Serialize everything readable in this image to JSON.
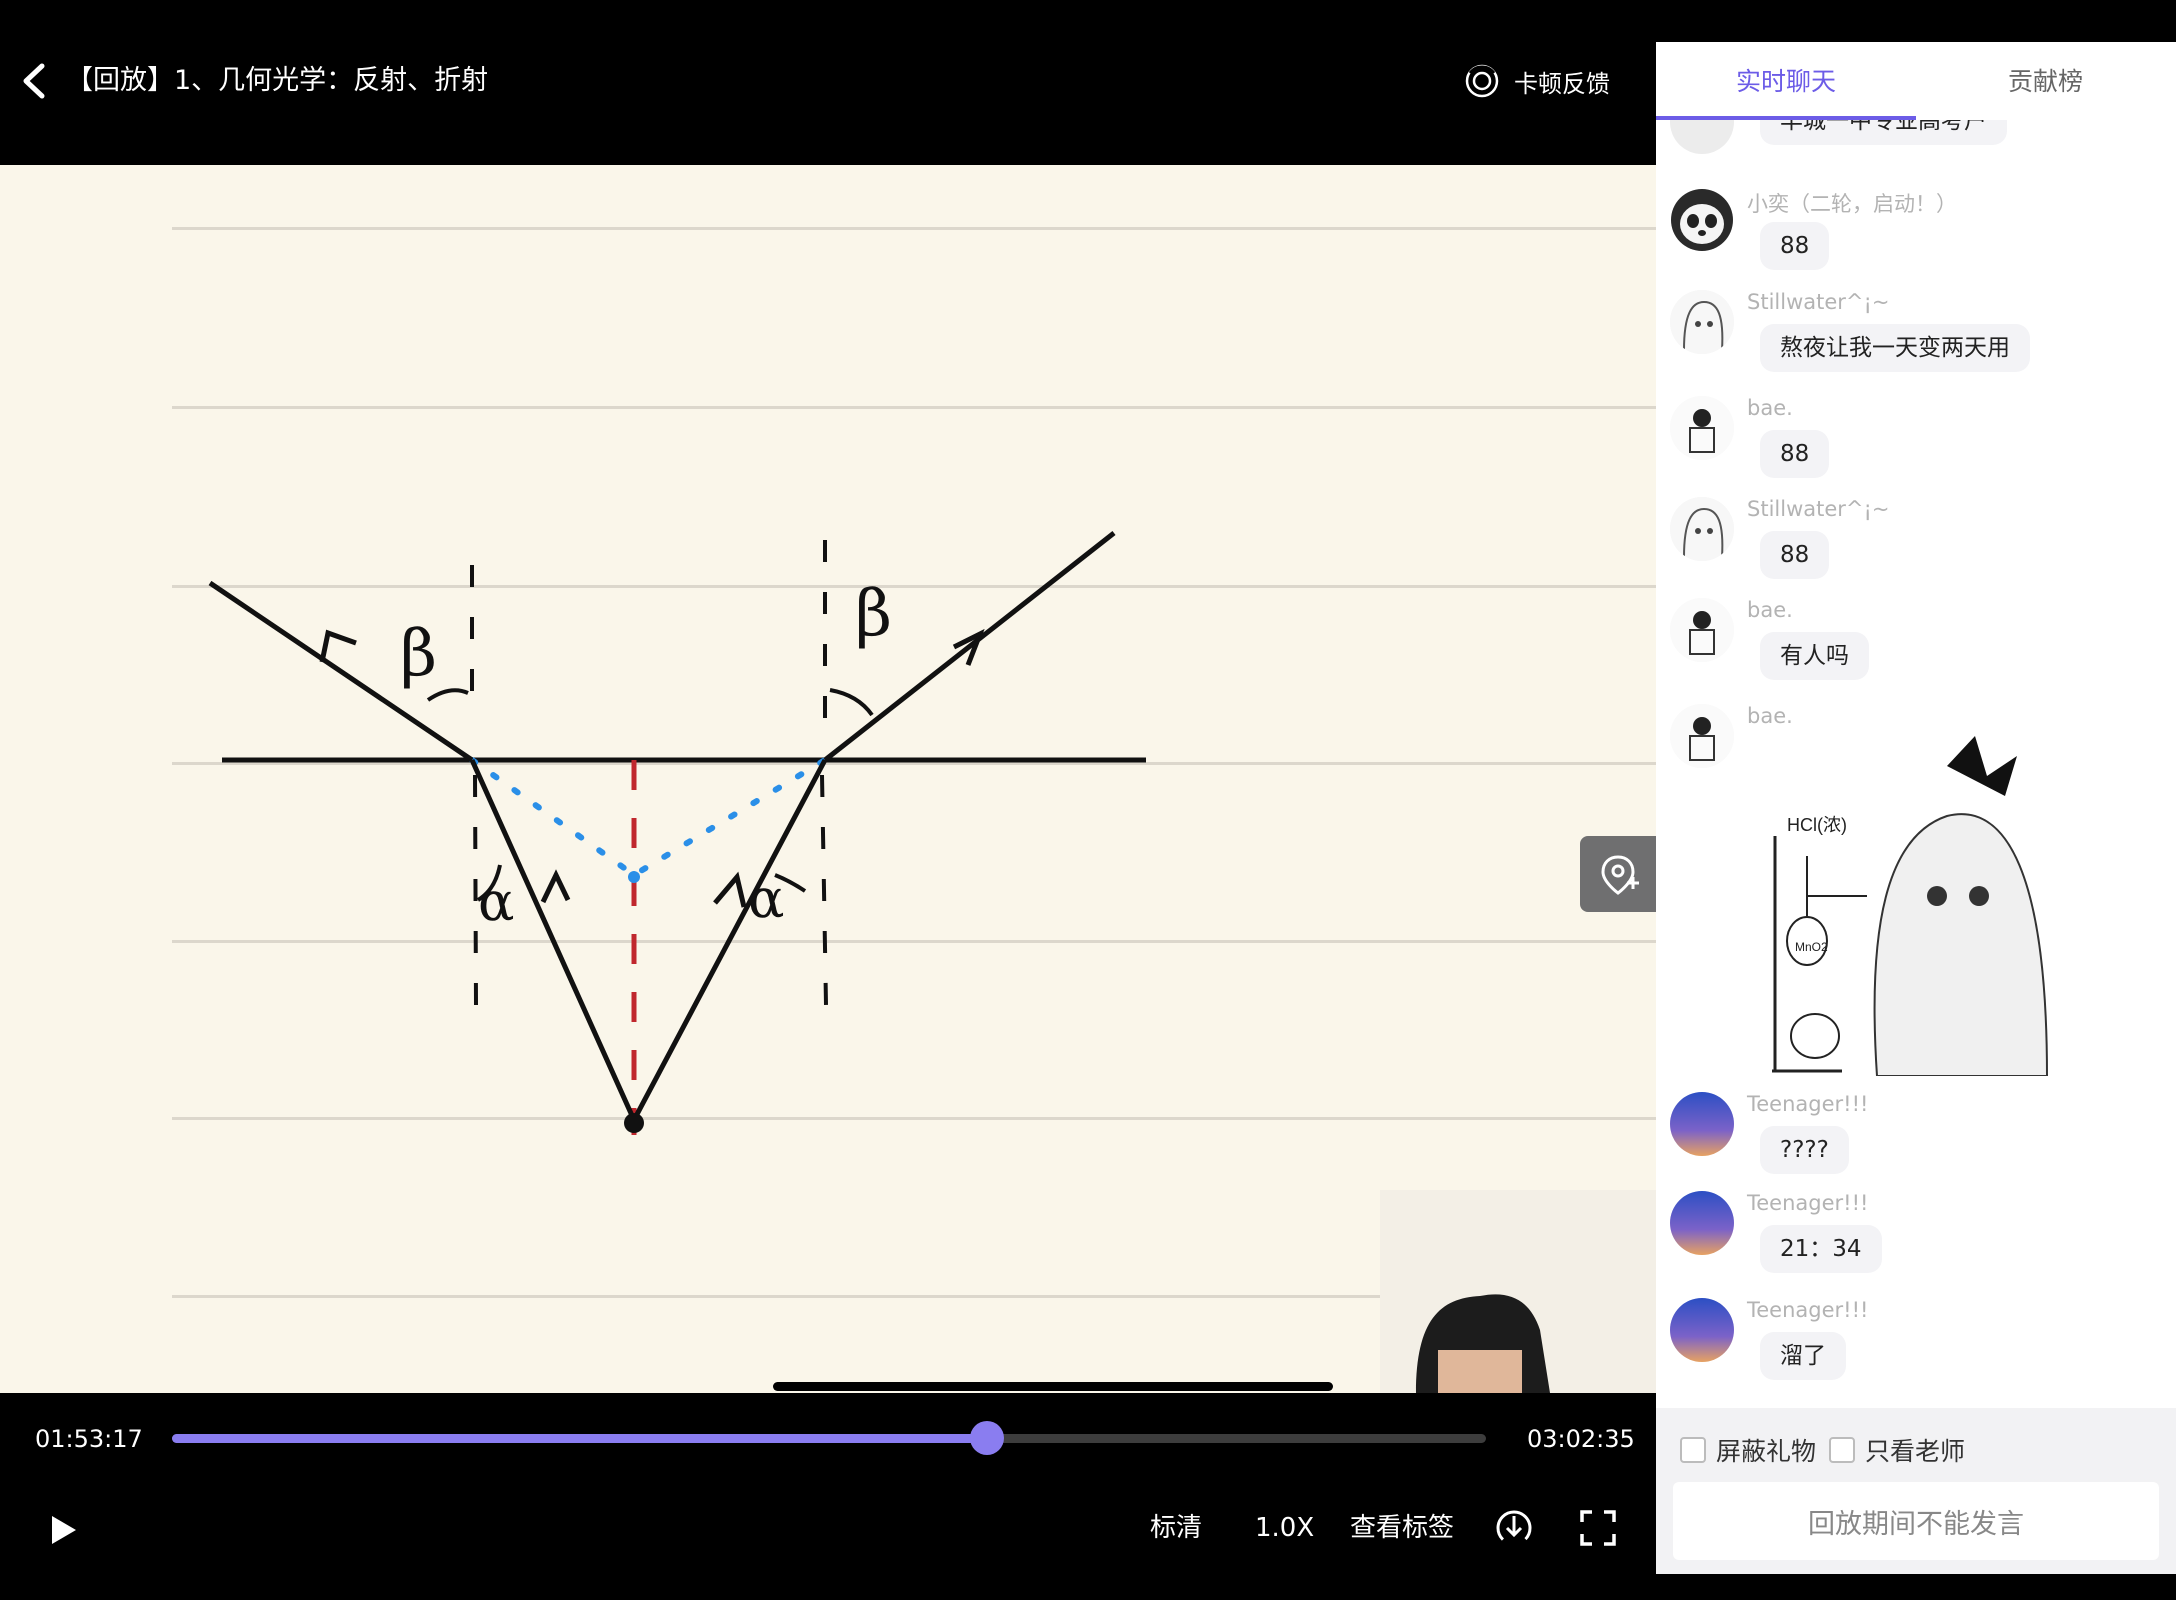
{
  "header": {
    "title": "【回放】1、几何光学：反射、折射",
    "feedback_label": "卡顿反馈"
  },
  "board": {
    "labels": [
      "β",
      "β",
      "α",
      "α"
    ]
  },
  "player": {
    "current_time": "01:53:17",
    "total_time": "03:02:35",
    "progress": 0.62,
    "quality_label": "标清",
    "speed_label": "1.0X",
    "tags_label": "查看标签"
  },
  "panel": {
    "tabs": [
      {
        "label": "实时聊天",
        "active": true
      },
      {
        "label": "贡献榜",
        "active": false
      }
    ],
    "messages": [
      {
        "user": "",
        "text": "丰城一中专业高考户",
        "avatar": "anime-sketch"
      },
      {
        "user": "小奕（二轮，启动！）",
        "text": "88",
        "avatar": "panda"
      },
      {
        "user": "Stillwater^¡~",
        "text": "熬夜让我一天变两天用",
        "avatar": "anime-sketch"
      },
      {
        "user": "bae.",
        "text": "88",
        "avatar": "boy-sketch"
      },
      {
        "user": "Stillwater^¡~",
        "text": "88",
        "avatar": "anime-sketch"
      },
      {
        "user": "bae.",
        "text": "有人吗",
        "avatar": "boy-sketch"
      },
      {
        "user": "bae.",
        "image_caption": "HCl(浓)",
        "image_sub": "MnO2",
        "avatar": "boy-sketch"
      },
      {
        "user": "Teenager!!!",
        "text": "????",
        "avatar": "sunset"
      },
      {
        "user": "Teenager!!!",
        "text": "21：34",
        "avatar": "sunset"
      },
      {
        "user": "Teenager!!!",
        "text": "溜了",
        "avatar": "sunset"
      }
    ],
    "options": [
      "屏蔽礼物",
      "只看老师"
    ],
    "input_placeholder": "回放期间不能发言"
  },
  "colors": {
    "accent": "#8a7df0",
    "tab_active": "#6c5ce7",
    "board_bg": "#faf6ea"
  }
}
